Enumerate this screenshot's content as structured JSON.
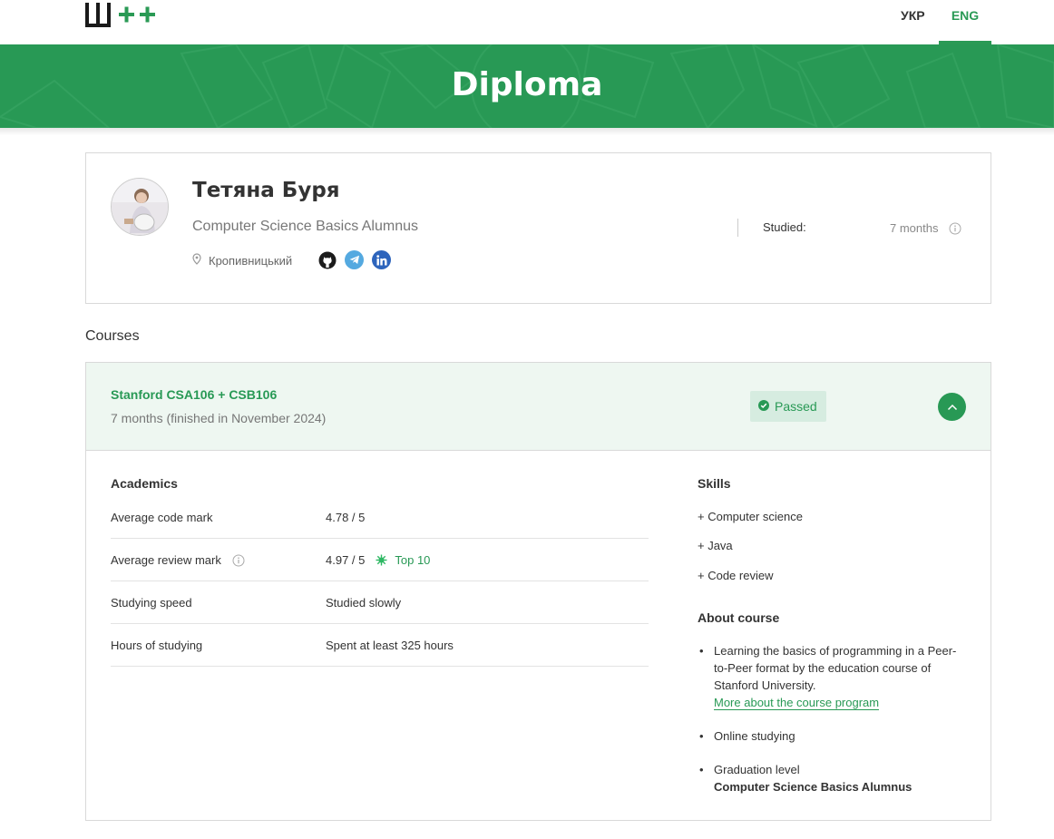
{
  "header": {
    "logo_text": "Ш++",
    "lang_ukr": "УКР",
    "lang_eng": "ENG"
  },
  "banner": {
    "title": "Diploma"
  },
  "profile": {
    "name": "Тетяна Буря",
    "title": "Computer Science Basics Alumnus",
    "location": "Кропивницький",
    "socials": [
      "github-icon",
      "telegram-icon",
      "linkedin-icon"
    ],
    "studied_label": "Studied:",
    "studied_value": "7 months"
  },
  "courses_heading": "Courses",
  "course": {
    "name": "Stanford CSA106 + CSB106",
    "duration": "7 months (finished in November 2024)",
    "status": "Passed",
    "academics": {
      "heading": "Academics",
      "rows": [
        {
          "label": "Average code mark",
          "value": "4.78 / 5"
        },
        {
          "label": "Average review mark",
          "value": "4.97 / 5",
          "badge": "Top 10"
        },
        {
          "label": "Studying speed",
          "value": "Studied slowly"
        },
        {
          "label": "Hours of studying",
          "value": "Spent at least 325 hours"
        }
      ]
    },
    "skills": {
      "heading": "Skills",
      "items": [
        "+ Computer science",
        "+ Java",
        "+ Code review"
      ]
    },
    "about": {
      "heading": "About course",
      "item1_text": "Learning the basics of programming in a Peer-to-Peer format by the education course of Stanford University.",
      "item1_link": "More about the course program",
      "item2_text": "Online studying",
      "item3_label": "Graduation level",
      "item3_value": "Computer Science Basics Alumnus"
    }
  },
  "colors": {
    "brand_green": "#289955",
    "head_bg": "#eef7f1",
    "passed_bg": "#d6ece0",
    "telegram": "#54a9e0",
    "linkedin": "#2d64bc"
  }
}
